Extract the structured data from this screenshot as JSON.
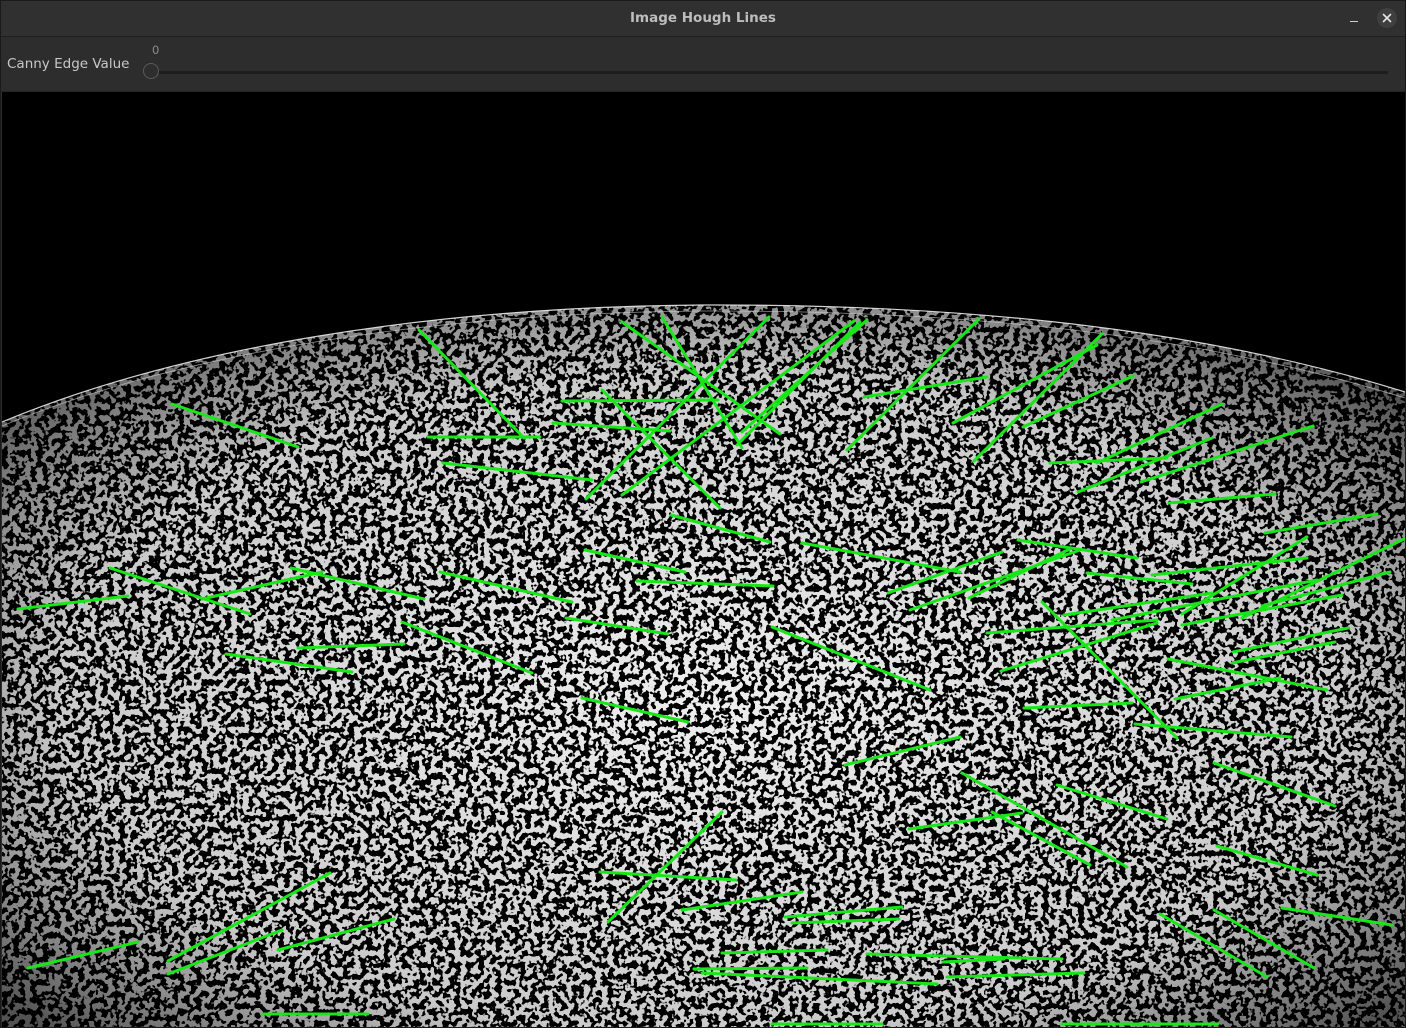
{
  "window": {
    "title": "Image Hough Lines"
  },
  "trackbar": {
    "label": "Canny Edge Value",
    "value": "0",
    "min": 0,
    "max": 255,
    "current": 0
  },
  "icons": {
    "minimize": "minimize-icon",
    "close": "close-icon"
  },
  "colors": {
    "hough_line": "#19e619",
    "edge": "#d8d8d8",
    "background": "#000000"
  },
  "image": {
    "content": "canny-edge-map",
    "overlay": "hough-line-segments"
  }
}
